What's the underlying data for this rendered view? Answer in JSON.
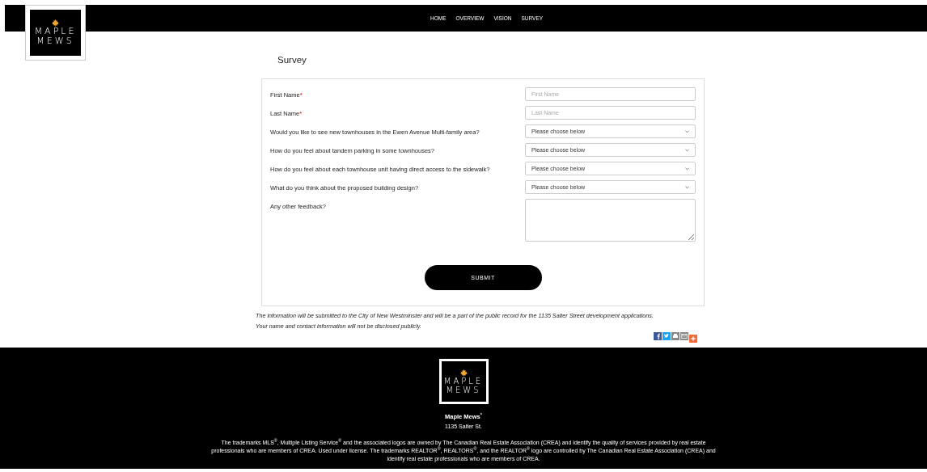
{
  "logo": {
    "line_1": "MAPLE",
    "line_2": "MEWS"
  },
  "nav": [
    {
      "label": "HOME"
    },
    {
      "label": "OVERVIEW"
    },
    {
      "label": "VISION"
    },
    {
      "label": "SURVEY"
    }
  ],
  "heading": "Survey",
  "fields": [
    {
      "kind": "text",
      "label": "First Name",
      "required_mark": "*",
      "placeholder": "First Name"
    },
    {
      "kind": "text",
      "label": "Last Name",
      "required_mark": "*",
      "placeholder": "Last Name"
    },
    {
      "kind": "select",
      "label": "Would you like to see new townhouses in the Ewen Avenue Multi-family area?",
      "value": "Please choose below"
    },
    {
      "kind": "select",
      "label": "How do you feel about tandem parking in some townhouses?",
      "value": "Please choose below"
    },
    {
      "kind": "select",
      "label": "How do you feel about each townhouse unit having direct access to the sidewalk?",
      "value": "Please choose below"
    },
    {
      "kind": "select",
      "label": "What do you think about the proposed building design?",
      "value": "Please choose below"
    },
    {
      "kind": "textarea",
      "label": "Any other feedback?"
    }
  ],
  "submit": "SUBMIT",
  "notice": [
    "The information will be submitted to the City of New Westminster and will be a part of the public record for the 1135 Salter Street development applications.",
    "Your name and contact information will not be disclosed publicly."
  ],
  "share": [
    {
      "kind": "facebook",
      "color": "#3b5998"
    },
    {
      "kind": "twitter",
      "color": "#1da1f2"
    },
    {
      "kind": "print",
      "color": "#888888"
    },
    {
      "kind": "email",
      "color": "#888888"
    },
    {
      "kind": "more",
      "color": "#f26b3a"
    }
  ],
  "footer": {
    "logo": {
      "line_1": "MAPLE",
      "line_2": "MEWS"
    },
    "name": "Maple Mews$^{*}$",
    "address": "1135 Salter St.",
    "legal": "The trademarks MLS$^{®}$, Multiple Listing Service$^{®}$ and the associated logos are owned by The Canadian Real Estate Association (CREA) and identify the quality of services provided by real estate professionals who are members of CREA. Used under license. The trademarks REALTOR$^{®}$, REALTORS$^{®}$, and the REALTOR$^{®}$ logo are controlled by The Canadian Real Estate Association (CREA) and identify real estate professionals who are members of CREA."
  }
}
